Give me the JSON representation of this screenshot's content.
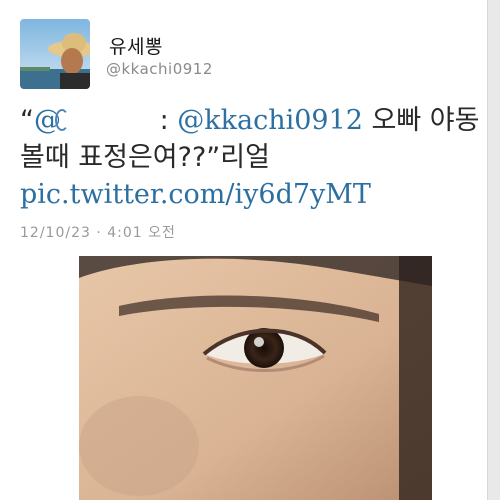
{
  "profile": {
    "avatar_icon": "profile-photo-man-in-straw-hat",
    "display_name": "유세뽕",
    "username": "@kkachi0912"
  },
  "tweet": {
    "open_quote": "“",
    "mention_1": "@",
    "colon": " : ",
    "mention_2": "@kkachi0912",
    "text_1": " 오빠 야동볼때 표정은여??”리얼 ",
    "link": "pic.twitter.com/iy6d7yMT"
  },
  "timestamp": "12/10/23 · 4:01 오전",
  "media": {
    "photo_icon": "close-up-eye-photo"
  },
  "colors": {
    "link": "#2c6fa1",
    "text": "#2a2a2a",
    "muted": "#8a8a8a"
  }
}
